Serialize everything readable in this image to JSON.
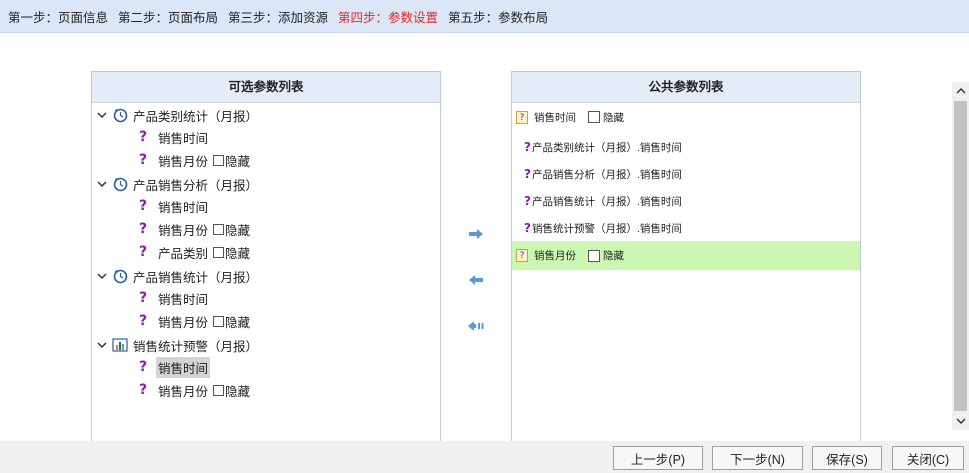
{
  "steps": [
    {
      "label": "第一步：页面信息",
      "active": false
    },
    {
      "label": "第二步：页面布局",
      "active": false
    },
    {
      "label": "第三步：添加资源",
      "active": false
    },
    {
      "label": "第四步：参数设置",
      "active": true
    },
    {
      "label": "第五步：参数布局",
      "active": false
    }
  ],
  "left_panel": {
    "title": "可选参数列表",
    "groups": [
      {
        "label": "产品类别统计（月报）",
        "icon": "clock-icon",
        "items": [
          {
            "label": "销售时间",
            "hide": false
          },
          {
            "label": "销售月份",
            "hide": true,
            "hide_label": "隐藏"
          }
        ]
      },
      {
        "label": "产品销售分析（月报）",
        "icon": "clock-icon",
        "items": [
          {
            "label": "销售时间",
            "hide": false
          },
          {
            "label": "销售月份",
            "hide": true,
            "hide_label": "隐藏"
          },
          {
            "label": "产品类别",
            "hide": true,
            "hide_label": "隐藏"
          }
        ]
      },
      {
        "label": "产品销售统计（月报）",
        "icon": "clock-icon",
        "items": [
          {
            "label": "销售时间",
            "hide": false
          },
          {
            "label": "销售月份",
            "hide": true,
            "hide_label": "隐藏"
          }
        ]
      },
      {
        "label": "销售统计预警（月报）",
        "icon": "chart-icon",
        "items": [
          {
            "label": "销售时间",
            "hide": false,
            "selected": true
          },
          {
            "label": "销售月份",
            "hide": true,
            "hide_label": "隐藏"
          }
        ]
      }
    ]
  },
  "right_panel": {
    "title": "公共参数列表",
    "rows": [
      {
        "type": "param",
        "label": "销售时间",
        "hide_label": "隐藏",
        "highlight": false
      },
      {
        "type": "ref",
        "label": "产品类别统计（月报）.销售时间"
      },
      {
        "type": "ref",
        "label": "产品销售分析（月报）.销售时间"
      },
      {
        "type": "ref",
        "label": "产品销售统计（月报）.销售时间"
      },
      {
        "type": "ref",
        "label": "销售统计预警（月报）.销售时间"
      },
      {
        "type": "param",
        "label": "销售月份",
        "hide_label": "隐藏",
        "highlight": true
      }
    ]
  },
  "buttons": {
    "prev": "上一步(P)",
    "next": "下一步(N)",
    "save": "保存(S)",
    "close": "关闭(C)"
  },
  "colors": {
    "active_step": "#e0282c",
    "header_bg": "#dbe7f7",
    "highlight_row": "#ccf7b3",
    "question_mark": "#8a1db3",
    "arrow_blue": "#5b9bd5"
  }
}
